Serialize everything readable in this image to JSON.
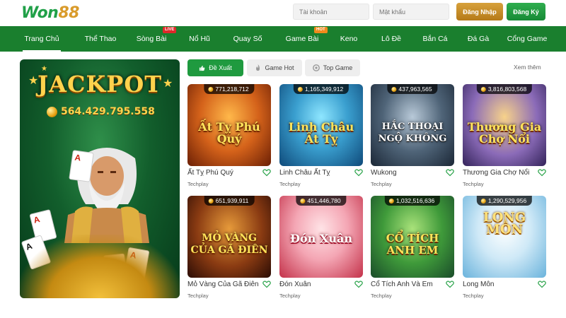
{
  "header": {
    "logo_prefix": "Won",
    "logo_number": "88",
    "username_placeholder": "Tài khoản",
    "password_placeholder": "Mật khẩu",
    "login_label": "Đăng Nhập",
    "register_label": "Đăng Ký"
  },
  "nav": {
    "items": [
      {
        "label": "Trang Chủ",
        "active": true
      },
      {
        "label": "Thể Thao"
      },
      {
        "label": "Sòng Bài",
        "badge": "LIVE"
      },
      {
        "label": "Nổ Hũ"
      },
      {
        "label": "Quay Số"
      },
      {
        "label": "Game Bài",
        "badge": "HOT"
      },
      {
        "label": "Keno"
      },
      {
        "label": "Lô Đề"
      },
      {
        "label": "Bắn Cá"
      },
      {
        "label": "Đá Gà"
      },
      {
        "label": "Cổng Game"
      }
    ]
  },
  "jackpot": {
    "title": "JACKPOT",
    "amount": "564.429.795.558"
  },
  "tabs": [
    {
      "label": "Đề Xuất",
      "icon": "thumbs-up-icon",
      "active": true
    },
    {
      "label": "Game Hot",
      "icon": "flame-icon"
    },
    {
      "label": "Top Game",
      "icon": "trophy-icon"
    }
  ],
  "see_more": "Xem thêm",
  "games": [
    {
      "thumb_text": "Ất Tỵ Phú Quý",
      "name": "Ất Tỵ Phú Quý",
      "provider": "Techplay",
      "jackpot": "771,218,712"
    },
    {
      "thumb_text": "Linh Châu Ất Tỵ",
      "name": "Linh Châu Ất Tỵ",
      "provider": "Techplay",
      "jackpot": "1,165,349,912"
    },
    {
      "thumb_text": "HẮC THOẠI NGỘ KHÔNG",
      "name": "Wukong",
      "provider": "Techplay",
      "jackpot": "437,963,565"
    },
    {
      "thumb_text": "Thương Gia Chợ Nổi",
      "name": "Thương Gia Chợ Nổi",
      "provider": "Techplay",
      "jackpot": "3,816,803,568"
    },
    {
      "thumb_text": "MỎ VÀNG CỦA GÃ ĐIÊN",
      "name": "Mỏ Vàng Của Gã Điên",
      "provider": "Techplay",
      "jackpot": "651,939,911"
    },
    {
      "thumb_text": "Đón Xuân",
      "name": "Đón Xuân",
      "provider": "Techplay",
      "jackpot": "451,446,780"
    },
    {
      "thumb_text": "CỔ TÍCH ANH EM",
      "name": "Cổ Tích Anh Và Em",
      "provider": "Techplay",
      "jackpot": "1,032,516,636"
    },
    {
      "thumb_text": "LONG MÔN",
      "name": "Long Môn",
      "provider": "Techplay",
      "jackpot": "1,290,529,956"
    }
  ],
  "colors": {
    "brand_green": "#1a7f2e",
    "gold": "#d7a13c",
    "button_green": "#1f9a3f"
  }
}
